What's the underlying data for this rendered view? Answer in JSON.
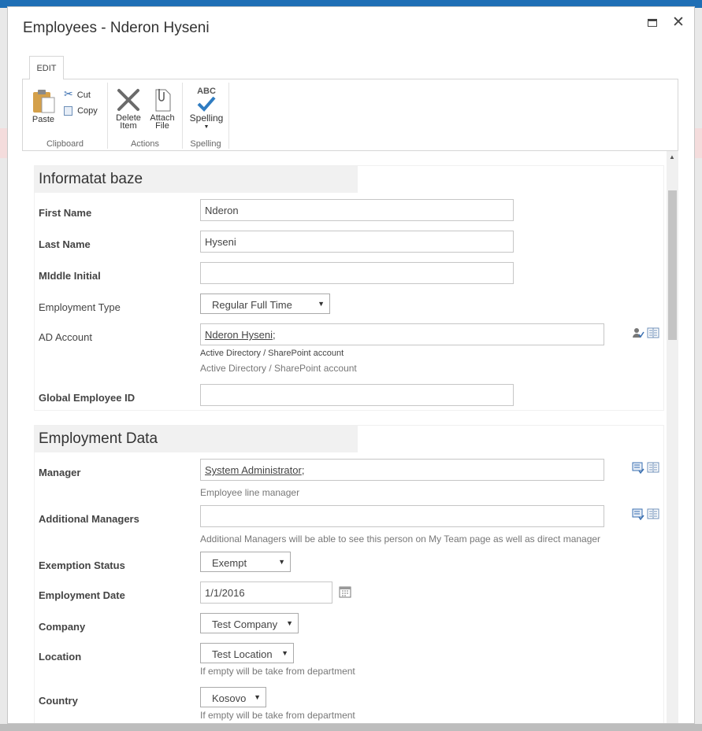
{
  "dialog": {
    "title": "Employees - Nderon Hyseni"
  },
  "ribbon": {
    "tab": "EDIT",
    "clipboard": {
      "paste": "Paste",
      "cut": "Cut",
      "copy": "Copy",
      "label": "Clipboard"
    },
    "actions": {
      "delete_l1": "Delete",
      "delete_l2": "Item",
      "attach_l1": "Attach",
      "attach_l2": "File",
      "label": "Actions"
    },
    "spelling": {
      "abc": "ABC",
      "button": "Spelling",
      "label": "Spelling"
    }
  },
  "section1": {
    "heading": "Informatat baze",
    "fields": {
      "first_name": {
        "label": "First Name",
        "value": "Nderon"
      },
      "last_name": {
        "label": "Last Name",
        "value": "Hyseni"
      },
      "middle": {
        "label": "MIddle Initial",
        "value": ""
      },
      "emp_type": {
        "label": "Employment Type",
        "value": "Regular Full Time"
      },
      "ad": {
        "label": "AD Account",
        "value": "Nderon Hyseni",
        "sep": ";",
        "hint1": "Active Directory / SharePoint account",
        "hint2": "Active Directory / SharePoint account"
      },
      "global_id": {
        "label": "Global Employee ID",
        "value": ""
      }
    }
  },
  "section2": {
    "heading": "Employment Data",
    "fields": {
      "manager": {
        "label": "Manager",
        "value": "System Administrator",
        "sep": ";",
        "hint": "Employee line manager"
      },
      "add_managers": {
        "label": "Additional Managers",
        "value": "",
        "hint": "Additional Managers will be able to see this person on My Team page as well as direct manager"
      },
      "exemption": {
        "label": "Exemption Status",
        "value": "Exempt"
      },
      "emp_date": {
        "label": "Employment Date",
        "value": "1/1/2016"
      },
      "company": {
        "label": "Company",
        "value": "Test Company"
      },
      "location": {
        "label": "Location",
        "value": "Test Location",
        "hint": "If empty will be take from department"
      },
      "country": {
        "label": "Country",
        "value": "Kosovo",
        "hint": "If empty will be take from department"
      }
    }
  },
  "colors": {
    "accent": "#1f6fb5",
    "section_bg": "#f1f1f1",
    "border": "#c6c6c6"
  }
}
